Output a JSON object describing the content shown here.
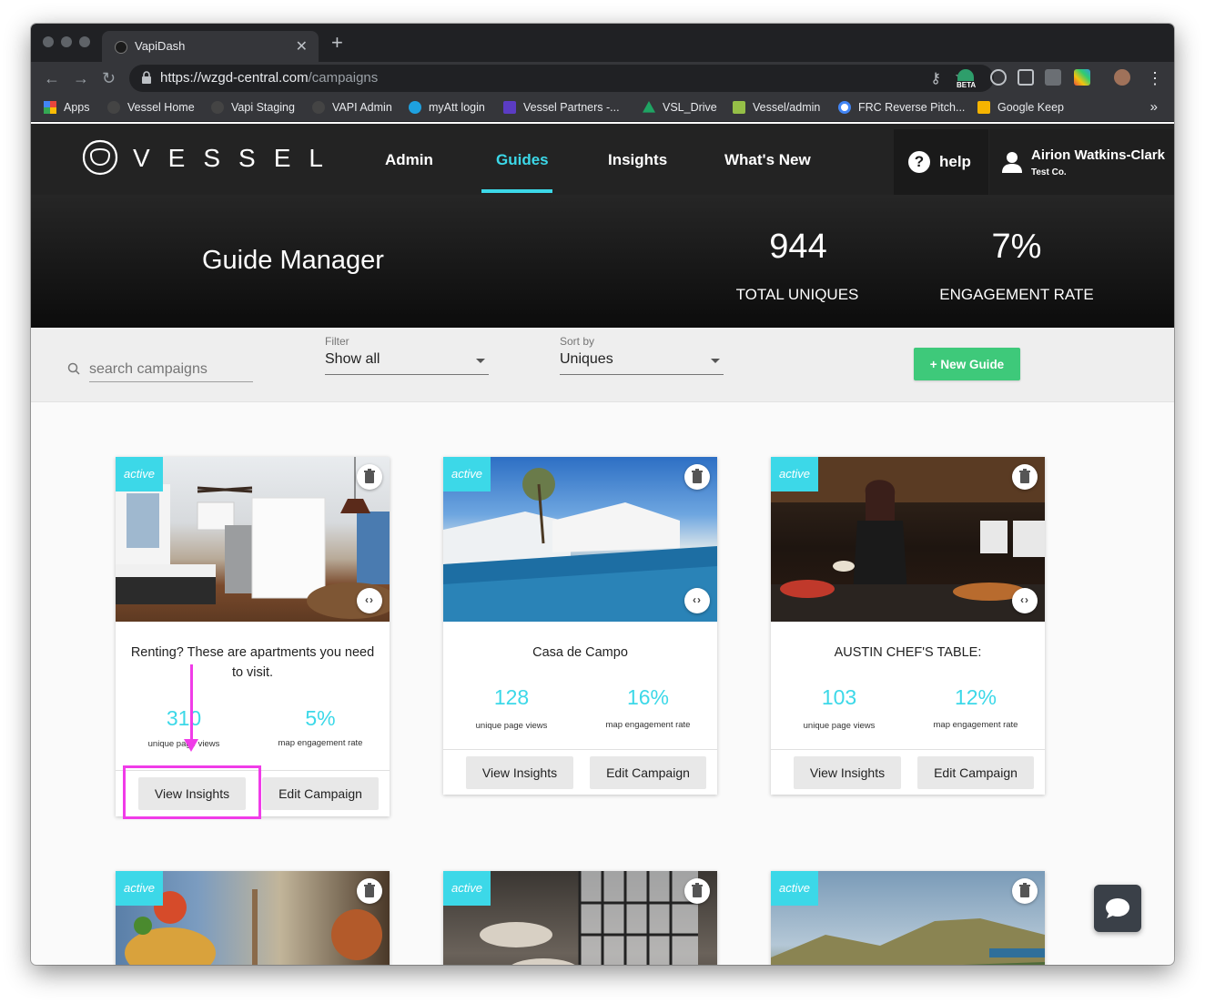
{
  "browser": {
    "tab_title": "VapiDash",
    "url_host": "https://wzgd-central.com",
    "url_path": "/campaigns",
    "beta_label": "BETA",
    "bookmarks": [
      {
        "label": "Apps",
        "color": "#e8453c"
      },
      {
        "label": "Vessel Home",
        "color": "#444444"
      },
      {
        "label": "Vapi Staging",
        "color": "#444444"
      },
      {
        "label": "VAPI Admin",
        "color": "#444444"
      },
      {
        "label": "myAtt login",
        "color": "#1ea1e0"
      },
      {
        "label": "Vessel Partners -...",
        "color": "#5b3cc4"
      },
      {
        "label": "VSL_Drive",
        "color": "#1fa463"
      },
      {
        "label": "Vessel/admin",
        "color": "#95bf47"
      },
      {
        "label": "FRC Reverse Pitch...",
        "color": "#ffffff"
      },
      {
        "label": "Google Keep",
        "color": "#f6b400"
      }
    ],
    "bookmarks_more": "»"
  },
  "header": {
    "logo_text": "VESSEL",
    "nav": [
      {
        "label": "Admin",
        "active": false
      },
      {
        "label": "Guides",
        "active": true
      },
      {
        "label": "Insights",
        "active": false
      },
      {
        "label": "What's New",
        "active": false
      }
    ],
    "help_label": "help",
    "user_name": "Airion Watkins-Clark",
    "user_org": "Test Co."
  },
  "hero": {
    "title": "Guide Manager",
    "stats": [
      {
        "value": "944",
        "label": "TOTAL UNIQUES"
      },
      {
        "value": "7%",
        "label": "ENGAGEMENT RATE"
      }
    ]
  },
  "filters": {
    "search_placeholder": "search campaigns",
    "filter_label": "Filter",
    "filter_value": "Show all",
    "sort_label": "Sort by",
    "sort_value": "Uniques",
    "new_guide_label": "+ New Guide"
  },
  "cards": [
    {
      "status": "active",
      "title": "Renting? These are apartments you need to visit.",
      "views": "310",
      "views_label": "unique page views",
      "rate": "5%",
      "rate_label": "map engagement rate",
      "btn_insights": "View Insights",
      "btn_edit": "Edit Campaign"
    },
    {
      "status": "active",
      "title": "Casa de Campo",
      "views": "128",
      "views_label": "unique page views",
      "rate": "16%",
      "rate_label": "map engagement rate",
      "btn_insights": "View Insights",
      "btn_edit": "Edit Campaign"
    },
    {
      "status": "active",
      "title": "AUSTIN CHEF'S TABLE:",
      "views": "103",
      "views_label": "unique page views",
      "rate": "12%",
      "rate_label": "map engagement rate",
      "btn_insights": "View Insights",
      "btn_edit": "Edit Campaign"
    },
    {
      "status": "active"
    },
    {
      "status": "active"
    },
    {
      "status": "active"
    }
  ],
  "colors": {
    "accent": "#3cd8e8",
    "primary_button": "#3ec97a",
    "annotation": "#f03ce8",
    "header_bg": "#232323"
  }
}
